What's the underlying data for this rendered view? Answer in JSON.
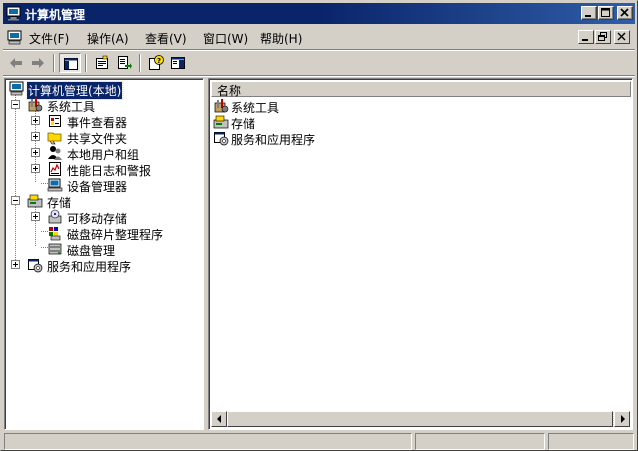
{
  "window": {
    "title": "计算机管理"
  },
  "menu": [
    {
      "label": "文件(F)"
    },
    {
      "label": "操作(A)"
    },
    {
      "label": "查看(V)"
    },
    {
      "label": "窗口(W)"
    },
    {
      "label": "帮助(H)"
    }
  ],
  "toolbar": {
    "buttons": [
      "back-arrow-icon",
      "forward-arrow-icon",
      "show-hide-tree-icon",
      "properties-icon",
      "export-list-icon",
      "help-icon",
      "action-pane-icon"
    ]
  },
  "tree": {
    "items": [
      {
        "label": "计算机管理(本地)",
        "icon": "computer-management-icon"
      },
      {
        "label": "系统工具",
        "icon": "system-tools-icon"
      },
      {
        "label": "事件查看器",
        "icon": "event-viewer-icon"
      },
      {
        "label": "共享文件夹",
        "icon": "shared-folders-icon"
      },
      {
        "label": "本地用户和组",
        "icon": "local-users-icon"
      },
      {
        "label": "性能日志和警报",
        "icon": "performance-logs-icon"
      },
      {
        "label": "设备管理器",
        "icon": "device-manager-icon"
      },
      {
        "label": "存储",
        "icon": "storage-icon"
      },
      {
        "label": "可移动存储",
        "icon": "removable-storage-icon"
      },
      {
        "label": "磁盘碎片整理程序",
        "icon": "defragmenter-icon"
      },
      {
        "label": "磁盘管理",
        "icon": "disk-management-icon"
      },
      {
        "label": "服务和应用程序",
        "icon": "services-applications-icon"
      }
    ]
  },
  "list": {
    "column_header": "名称",
    "items": [
      {
        "label": "系统工具",
        "icon": "system-tools-icon"
      },
      {
        "label": "存储",
        "icon": "storage-icon"
      },
      {
        "label": "服务和应用程序",
        "icon": "services-applications-icon"
      }
    ]
  },
  "colors": {
    "titlebar": "#0a246a",
    "face": "#d4d0c8",
    "selection": "#0a246a"
  }
}
